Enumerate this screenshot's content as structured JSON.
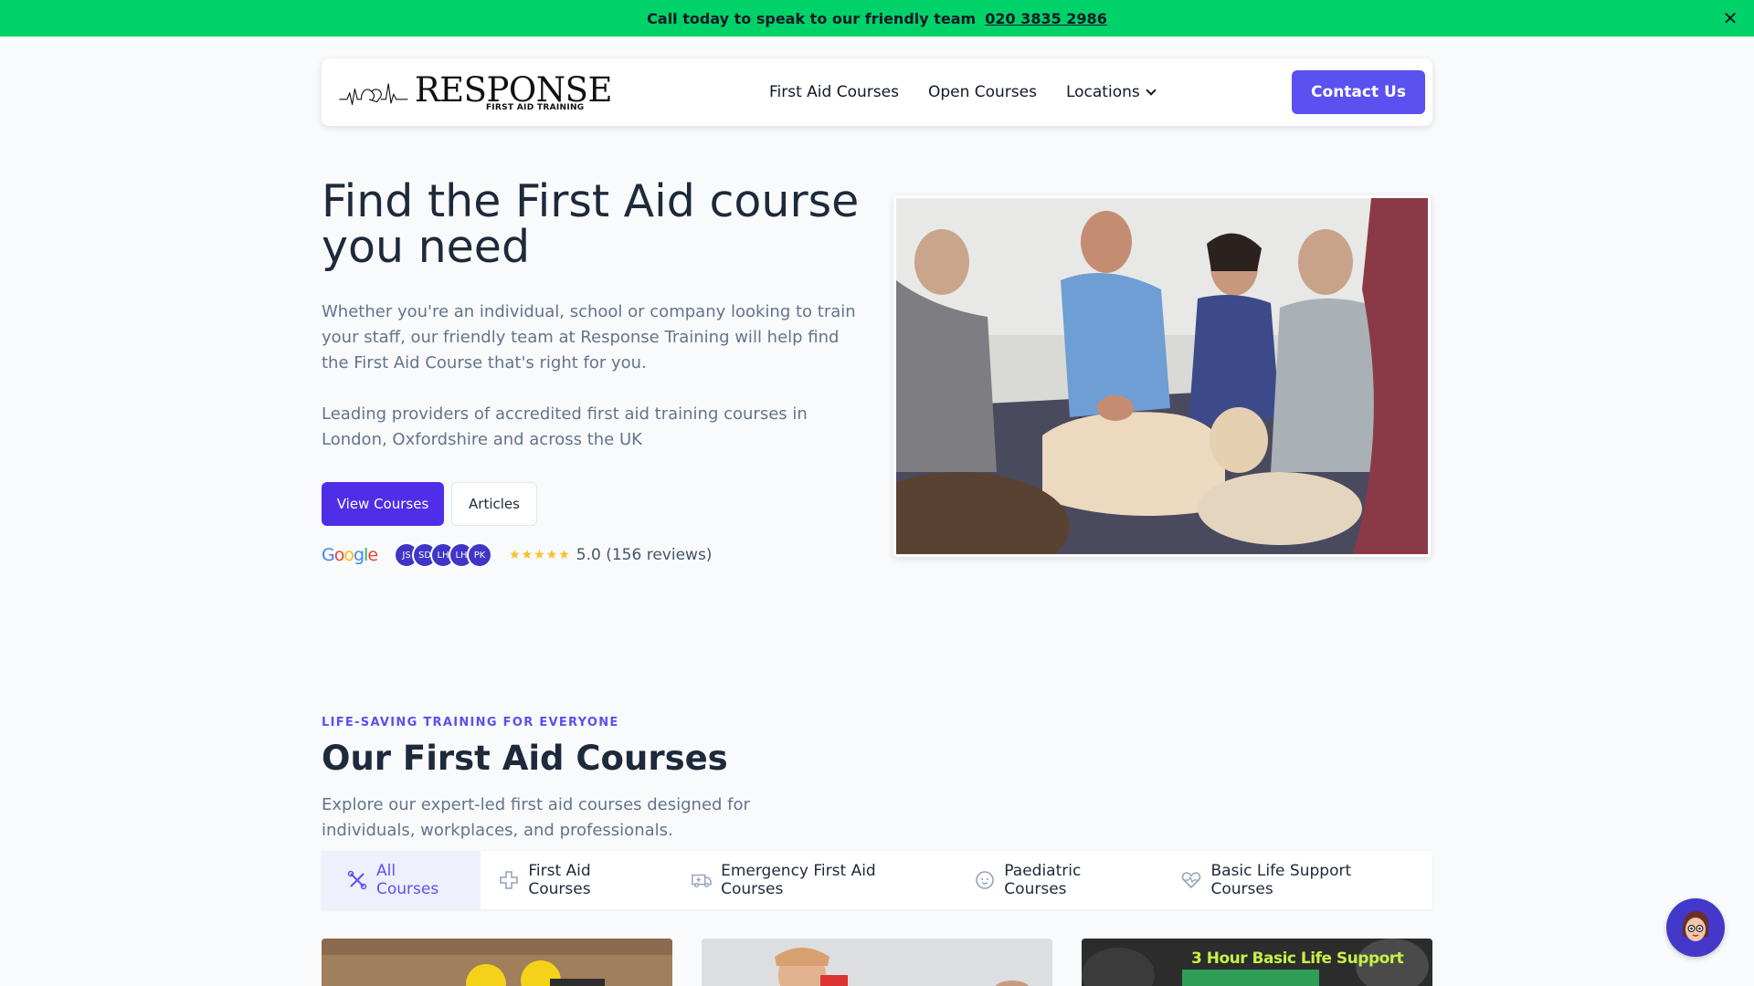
{
  "banner": {
    "text": "Call today to speak to our friendly team",
    "phone": "020 3835 2986",
    "close_icon": "close-icon"
  },
  "nav": {
    "logo_word": "RESPONSE",
    "logo_sub": "FIRST AID TRAINING",
    "links": [
      {
        "label": "First Aid Courses"
      },
      {
        "label": "Open Courses"
      },
      {
        "label": "Locations",
        "icon": "chevron-down-icon"
      }
    ],
    "contact_label": "Contact Us"
  },
  "hero": {
    "title": "Find the First Aid course you need",
    "paragraph1": "Whether you're an individual, school or company looking to train your staff, our friendly team at Response Training will help find the First Aid Course that's right for you.",
    "paragraph2": "Leading providers of accredited first aid training courses in London, Oxfordshire and across the UK",
    "primary_button": "View Courses",
    "secondary_button": "Articles",
    "reviews": {
      "provider": "Google",
      "avatars": [
        "JS",
        "SD",
        "LH",
        "LH",
        "PK"
      ],
      "stars": "★★★★★",
      "rating_text": "5.0 (156 reviews)"
    }
  },
  "courses": {
    "eyebrow": "LIFE-SAVING TRAINING FOR EVERYONE",
    "title": "Our First Aid Courses",
    "description": "Explore our expert-led first aid courses designed for individuals, workplaces, and professionals.",
    "tabs": [
      {
        "label": "All Courses",
        "icon": "tools-icon",
        "active": true
      },
      {
        "label": "First Aid Courses",
        "icon": "medical-cross-icon"
      },
      {
        "label": "Emergency First Aid Courses",
        "icon": "ambulance-icon"
      },
      {
        "label": "Paediatric Courses",
        "icon": "baby-face-icon"
      },
      {
        "label": "Basic Life Support Courses",
        "icon": "heartbeat-icon"
      }
    ],
    "card3_label": "3 Hour Basic Life Support"
  },
  "colors": {
    "banner": "#00d26a",
    "accent": "#5b50f0",
    "primary_button": "#4f2ee8",
    "star": "#fbbf24"
  }
}
